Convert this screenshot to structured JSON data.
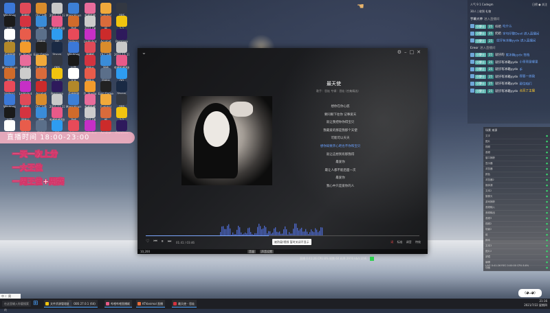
{
  "desktop": {
    "overlay": {
      "time_banner": "直播时间  18:00-23:00",
      "lines": [
        "一天一次上分",
        "一大王位",
        "一周王位+周赛"
      ]
    },
    "icons": [
      {
        "label": "Windows",
        "color": "#3b78d8"
      },
      {
        "label": "直播姬",
        "color": "#e04a58"
      },
      {
        "label": "DLC下载",
        "color": "#d98c2c"
      },
      {
        "label": "2021.11.17",
        "color": "#c8c8c8"
      },
      {
        "label": "MagicAzure",
        "color": "#3c7fd6"
      },
      {
        "label": "哔哩哔哩",
        "color": "#e86c9b"
      },
      {
        "label": "Funimal",
        "color": "#f0a93b"
      },
      {
        "label": "OBS",
        "color": "#333842"
      },
      {
        "label": "抖音",
        "color": "#1a1a1a"
      },
      {
        "label": "网易云",
        "color": "#d4333f"
      },
      {
        "label": "网络",
        "color": "#3a8cd8"
      },
      {
        "label": "哔哩哔哩直播",
        "color": "#e85a89"
      },
      {
        "label": "游戏",
        "color": "#d06b2b"
      },
      {
        "label": "2021.08",
        "color": "#cccccc"
      },
      {
        "label": "帆",
        "color": "#d96b3b"
      },
      {
        "label": "1-1",
        "color": "#f1c40f"
      },
      {
        "label": "文本",
        "color": "#ffffff"
      },
      {
        "label": "摄像头",
        "color": "#e85c4b"
      },
      {
        "label": "回收站",
        "color": "#5b6f8a"
      },
      {
        "label": "QQ",
        "color": "#2e9cf0"
      },
      {
        "label": "bigboss",
        "color": "#e84a59"
      },
      {
        "label": "Lightshot",
        "color": "#c62fc6"
      },
      {
        "label": "Acrobat",
        "color": "#cc2b2b"
      },
      {
        "label": "Premiere",
        "color": "#2e1a5c"
      },
      {
        "label": "英雄联盟",
        "color": "#b3882a"
      },
      {
        "label": "FL Studio",
        "color": "#f29b2c"
      },
      {
        "label": "Epic Games",
        "color": "#222222"
      },
      {
        "label": "Steam",
        "color": "#1a2a44"
      }
    ]
  },
  "player": {
    "song_title": "最天使",
    "song_meta": "歌手：思娃   专辑：思娃 (合集精选)",
    "lyrics": [
      "想你在你心底",
      "要同眼下往你 记事爱天",
      "就让我把你你得宝贝",
      "我最爱的那是我那个天使",
      "可能可以天天",
      "想你知要开心吧也不你和宝贝",
      "就让这想到有那我得",
      "最爱你",
      "最让人都不能后面一次",
      "最爱你",
      "我心中只是爱你的人"
    ],
    "active_lyric_index": 5,
    "time": "01:41 / 03:46",
    "progress": 0.45,
    "tooltip": "被防窥/视频  暂时关闭不显示",
    "mode_labels": [
      "词",
      "标准",
      "调音",
      "特效"
    ],
    "bottom_left": "10,200",
    "bottom_tags": [
      "音量",
      "声音设置"
    ]
  },
  "status_strip": "直播 0:41:26   CPU 8%  帧数 60  码率 2976 kb/s  LIVE",
  "chat": {
    "top_left": "人气 9   1 Codegm",
    "top_right": "日榜  ●  关注",
    "top_line2": "30人 | 收到 礼物",
    "messages": [
      {
        "kind": "enter",
        "name": "字幕大神",
        "text": "进入直播间"
      },
      {
        "kind": "msg",
        "badge": "小野士",
        "level": "25",
        "name": "抖奶",
        "text": "吃什么"
      },
      {
        "kind": "msg",
        "badge": "小野士",
        "level": "25",
        "name": "奶奶",
        "text": "字句仔整Devil 进入直播间"
      },
      {
        "kind": "msg",
        "badge": "小野士",
        "level": "25",
        "name": "",
        "text": "就仔有冰箱yydx 进入直播间"
      },
      {
        "kind": "enter",
        "name": "Ereor",
        "text": "进入直播间"
      },
      {
        "kind": "msg",
        "badge": "小野士",
        "level": "25",
        "name": "就仔的",
        "text": "家冰箱yydx 签档"
      },
      {
        "kind": "msg",
        "badge": "小野士",
        "level": "25",
        "name": "就仔有冰箱yydx",
        "text": "小哥哥是哪里"
      },
      {
        "kind": "msg",
        "badge": "小野士",
        "level": "25",
        "name": "就仔有冰箱yydx",
        "text": "手"
      },
      {
        "kind": "msg",
        "badge": "小野士",
        "level": "25",
        "name": "就仔有冰箱yydx",
        "text": "得要一首我"
      },
      {
        "kind": "msg",
        "badge": "小野士",
        "level": "25",
        "name": "就仔有冰箱yydx",
        "text": "那位咱们"
      },
      {
        "kind": "msg",
        "badge": "小野士",
        "level": "25",
        "name": "就仔有冰箱yydx",
        "text": "点亮了主播"
      }
    ]
  },
  "obs_panel": {
    "header": "场景  来源",
    "rows": [
      "文字",
      "图片",
      "视频",
      "音频",
      "窗口捕获",
      "显示器",
      "浏览器",
      "颜色",
      "浏览器2",
      "媒体源",
      "文本2",
      "摄像头",
      "游戏捕获",
      "音频输入",
      "音频输出",
      "音频3",
      "视频2",
      "场景2",
      "组",
      "脚本",
      "文本3",
      "图片2",
      "滤镜",
      "编辑",
      "动画"
    ],
    "footer": "LIVE 0:41:26   REC 0:00:00   CPU 8.6%"
  },
  "taskbar": {
    "search_placeholder": "在这里输入你要搜索的",
    "apps": [
      "文件资源管理器",
      "OBS 27.0.1 (64)",
      "哔哩哔哩直播姬",
      "KTVanimal 直播",
      "最天使 - 思娃"
    ],
    "tray": [
      "21:16",
      "2021/7/22 星期四"
    ],
    "bot_badge": "(◕ᴗ◕)"
  },
  "ime": "中 ☾ 简",
  "colors": {
    "accent": "#4aa3ff",
    "lyric_active": "#6aa0ff",
    "chat_badge": "#5fb7b2",
    "overlay_pink": "#ffb6c8"
  }
}
